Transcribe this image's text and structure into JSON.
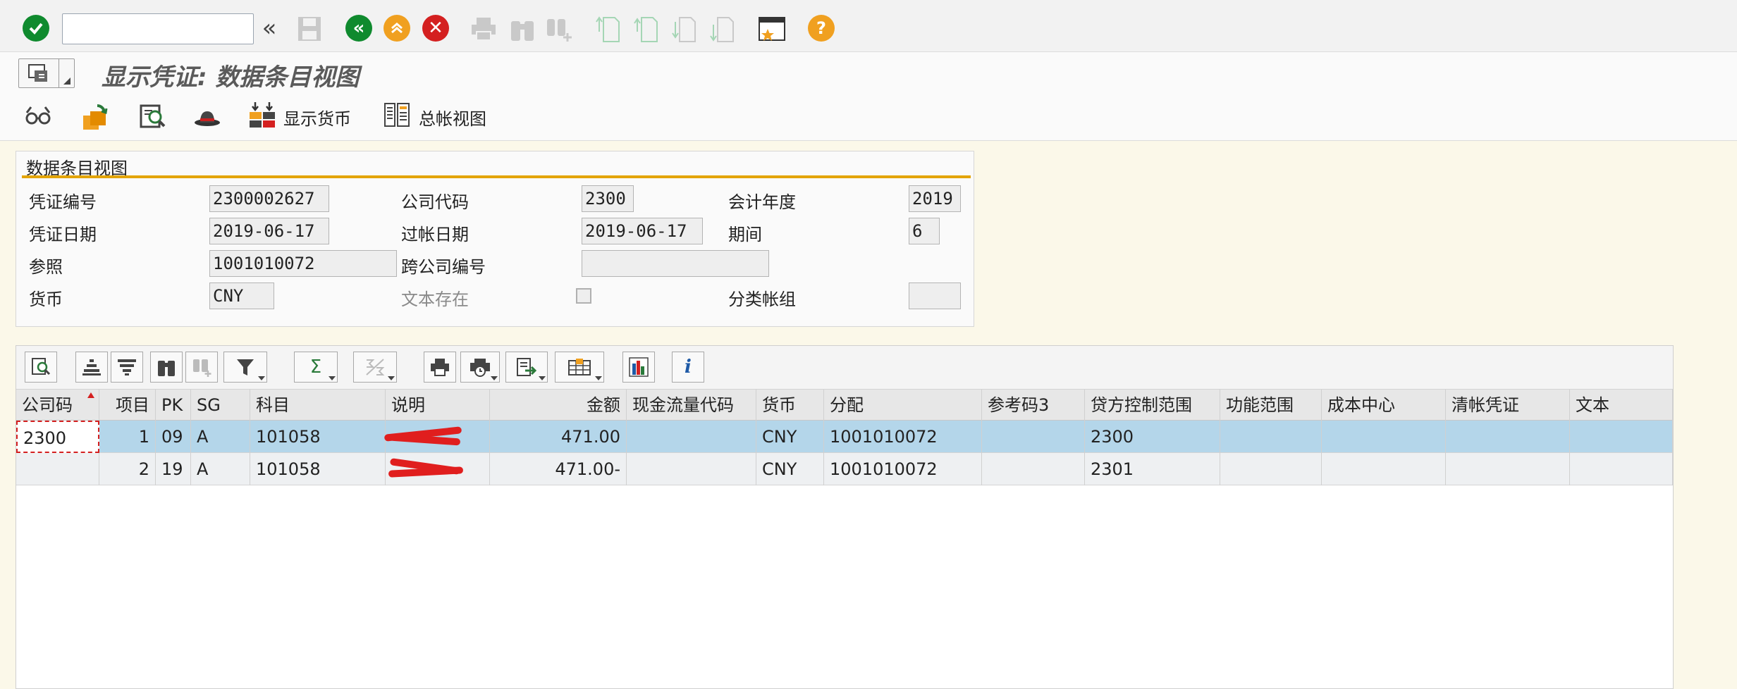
{
  "toolbar": {
    "command_value": "",
    "icons": [
      "enter-icon",
      "back-history-icon",
      "save-icon",
      "back-icon",
      "exit-icon",
      "cancel-icon",
      "print-icon",
      "find-icon",
      "find-next-icon",
      "first-page-icon",
      "previous-page-icon",
      "next-page-icon",
      "last-page-icon",
      "new-session-icon",
      "help-icon"
    ],
    "colors": {
      "ok": "#0f8a2e",
      "back": "#0f8a2e",
      "exit": "#f0a020",
      "cancel": "#d42020",
      "help": "#f0a020"
    }
  },
  "title": "显示凭证: 数据条目视图",
  "app_toolbar": {
    "display_currency": "显示货币",
    "gl_view": "总帐视图"
  },
  "header": {
    "section_title": "数据条目视图",
    "doc_number": {
      "label": "凭证编号",
      "value": "2300002627"
    },
    "company_code": {
      "label": "公司代码",
      "value": "2300"
    },
    "fiscal_year": {
      "label": "会计年度",
      "value": "2019"
    },
    "doc_date": {
      "label": "凭证日期",
      "value": "2019-06-17"
    },
    "posting_date": {
      "label": "过帐日期",
      "value": "2019-06-17"
    },
    "period": {
      "label": "期间",
      "value": "6"
    },
    "reference": {
      "label": "参照",
      "value": "1001010072"
    },
    "cross_company": {
      "label": "跨公司编号",
      "value": ""
    },
    "currency": {
      "label": "货币",
      "value": "CNY"
    },
    "text_exists": {
      "label": "文本存在",
      "checked": false
    },
    "ledger_group": {
      "label": "分类帐组",
      "value": ""
    }
  },
  "grid": {
    "toolbar_icons": [
      "details-icon",
      "sort-ascending-icon",
      "sort-descending-icon",
      "find-icon",
      "find-next-icon",
      "filter-icon",
      "sum-icon",
      "subtotal-icon",
      "print-icon",
      "views-icon",
      "export-icon",
      "layout-icon",
      "graphic-icon",
      "info-icon"
    ],
    "sum_symbol": "Σ",
    "info_symbol": "i",
    "columns": [
      "公司码",
      "项目",
      "PK",
      "SG",
      "科目",
      "说明",
      "金额",
      "现金流量代码",
      "货币",
      "分配",
      "参考码3",
      "贷方控制范围",
      "功能范围",
      "成本中心",
      "清帐凭证",
      "文本"
    ],
    "rows": [
      {
        "company": "2300",
        "item": "1",
        "pk": "09",
        "sg": "A",
        "account": "101058",
        "description": "",
        "amount": "471.00",
        "cashflow": "",
        "currency": "CNY",
        "assignment": "1001010072",
        "ref3": "",
        "credit_control": "2300",
        "func_area": "",
        "cost_center": "",
        "clearing_doc": "",
        "text": ""
      },
      {
        "company": "",
        "item": "2",
        "pk": "19",
        "sg": "A",
        "account": "101058",
        "description": "",
        "amount": "471.00-",
        "cashflow": "",
        "currency": "CNY",
        "assignment": "1001010072",
        "ref3": "",
        "credit_control": "2301",
        "func_area": "",
        "cost_center": "",
        "clearing_doc": "",
        "text": ""
      }
    ]
  }
}
